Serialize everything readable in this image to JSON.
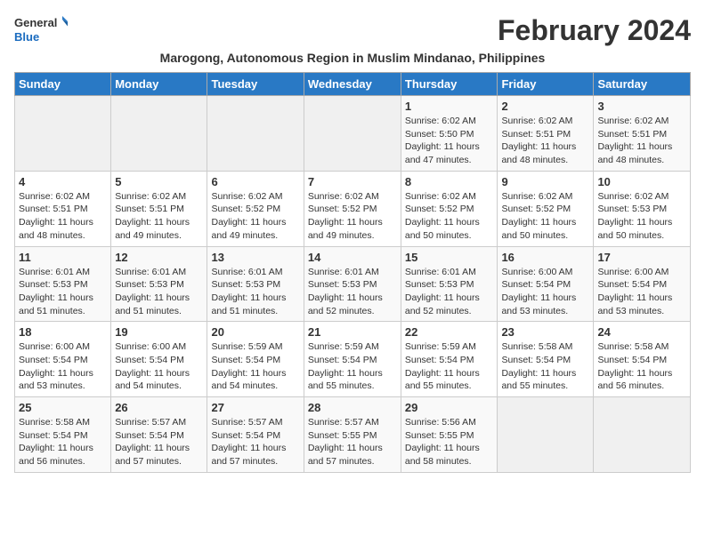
{
  "logo": {
    "general": "General",
    "blue": "Blue"
  },
  "title": "February 2024",
  "subtitle": "Marogong, Autonomous Region in Muslim Mindanao, Philippines",
  "weekdays": [
    "Sunday",
    "Monday",
    "Tuesday",
    "Wednesday",
    "Thursday",
    "Friday",
    "Saturday"
  ],
  "weeks": [
    [
      {
        "day": "",
        "info": ""
      },
      {
        "day": "",
        "info": ""
      },
      {
        "day": "",
        "info": ""
      },
      {
        "day": "",
        "info": ""
      },
      {
        "day": "1",
        "info": "Sunrise: 6:02 AM\nSunset: 5:50 PM\nDaylight: 11 hours and 47 minutes."
      },
      {
        "day": "2",
        "info": "Sunrise: 6:02 AM\nSunset: 5:51 PM\nDaylight: 11 hours and 48 minutes."
      },
      {
        "day": "3",
        "info": "Sunrise: 6:02 AM\nSunset: 5:51 PM\nDaylight: 11 hours and 48 minutes."
      }
    ],
    [
      {
        "day": "4",
        "info": "Sunrise: 6:02 AM\nSunset: 5:51 PM\nDaylight: 11 hours and 48 minutes."
      },
      {
        "day": "5",
        "info": "Sunrise: 6:02 AM\nSunset: 5:51 PM\nDaylight: 11 hours and 49 minutes."
      },
      {
        "day": "6",
        "info": "Sunrise: 6:02 AM\nSunset: 5:52 PM\nDaylight: 11 hours and 49 minutes."
      },
      {
        "day": "7",
        "info": "Sunrise: 6:02 AM\nSunset: 5:52 PM\nDaylight: 11 hours and 49 minutes."
      },
      {
        "day": "8",
        "info": "Sunrise: 6:02 AM\nSunset: 5:52 PM\nDaylight: 11 hours and 50 minutes."
      },
      {
        "day": "9",
        "info": "Sunrise: 6:02 AM\nSunset: 5:52 PM\nDaylight: 11 hours and 50 minutes."
      },
      {
        "day": "10",
        "info": "Sunrise: 6:02 AM\nSunset: 5:53 PM\nDaylight: 11 hours and 50 minutes."
      }
    ],
    [
      {
        "day": "11",
        "info": "Sunrise: 6:01 AM\nSunset: 5:53 PM\nDaylight: 11 hours and 51 minutes."
      },
      {
        "day": "12",
        "info": "Sunrise: 6:01 AM\nSunset: 5:53 PM\nDaylight: 11 hours and 51 minutes."
      },
      {
        "day": "13",
        "info": "Sunrise: 6:01 AM\nSunset: 5:53 PM\nDaylight: 11 hours and 51 minutes."
      },
      {
        "day": "14",
        "info": "Sunrise: 6:01 AM\nSunset: 5:53 PM\nDaylight: 11 hours and 52 minutes."
      },
      {
        "day": "15",
        "info": "Sunrise: 6:01 AM\nSunset: 5:53 PM\nDaylight: 11 hours and 52 minutes."
      },
      {
        "day": "16",
        "info": "Sunrise: 6:00 AM\nSunset: 5:54 PM\nDaylight: 11 hours and 53 minutes."
      },
      {
        "day": "17",
        "info": "Sunrise: 6:00 AM\nSunset: 5:54 PM\nDaylight: 11 hours and 53 minutes."
      }
    ],
    [
      {
        "day": "18",
        "info": "Sunrise: 6:00 AM\nSunset: 5:54 PM\nDaylight: 11 hours and 53 minutes."
      },
      {
        "day": "19",
        "info": "Sunrise: 6:00 AM\nSunset: 5:54 PM\nDaylight: 11 hours and 54 minutes."
      },
      {
        "day": "20",
        "info": "Sunrise: 5:59 AM\nSunset: 5:54 PM\nDaylight: 11 hours and 54 minutes."
      },
      {
        "day": "21",
        "info": "Sunrise: 5:59 AM\nSunset: 5:54 PM\nDaylight: 11 hours and 55 minutes."
      },
      {
        "day": "22",
        "info": "Sunrise: 5:59 AM\nSunset: 5:54 PM\nDaylight: 11 hours and 55 minutes."
      },
      {
        "day": "23",
        "info": "Sunrise: 5:58 AM\nSunset: 5:54 PM\nDaylight: 11 hours and 55 minutes."
      },
      {
        "day": "24",
        "info": "Sunrise: 5:58 AM\nSunset: 5:54 PM\nDaylight: 11 hours and 56 minutes."
      }
    ],
    [
      {
        "day": "25",
        "info": "Sunrise: 5:58 AM\nSunset: 5:54 PM\nDaylight: 11 hours and 56 minutes."
      },
      {
        "day": "26",
        "info": "Sunrise: 5:57 AM\nSunset: 5:54 PM\nDaylight: 11 hours and 57 minutes."
      },
      {
        "day": "27",
        "info": "Sunrise: 5:57 AM\nSunset: 5:54 PM\nDaylight: 11 hours and 57 minutes."
      },
      {
        "day": "28",
        "info": "Sunrise: 5:57 AM\nSunset: 5:55 PM\nDaylight: 11 hours and 57 minutes."
      },
      {
        "day": "29",
        "info": "Sunrise: 5:56 AM\nSunset: 5:55 PM\nDaylight: 11 hours and 58 minutes."
      },
      {
        "day": "",
        "info": ""
      },
      {
        "day": "",
        "info": ""
      }
    ]
  ]
}
